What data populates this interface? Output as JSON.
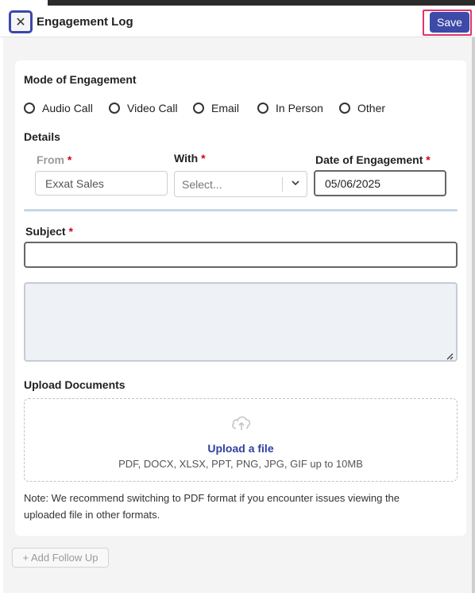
{
  "header": {
    "title": "Engagement Log",
    "close_label": "✕",
    "save_label": "Save"
  },
  "mode": {
    "label": "Mode of Engagement",
    "options": [
      "Audio Call",
      "Video Call",
      "Email",
      "In Person",
      "Other"
    ]
  },
  "details": {
    "label": "Details",
    "from_label": "From",
    "from_value": "Exxat Sales",
    "with_label": "With",
    "with_placeholder": "Select...",
    "date_label": "Date of Engagement",
    "date_value": "05/06/2025",
    "required_mark": "*"
  },
  "subject": {
    "label": "Subject",
    "value": ""
  },
  "upload": {
    "label": "Upload Documents",
    "title": "Upload a file",
    "subtitle": "PDF, DOCX, XLSX, PPT, PNG, JPG, GIF up to 10MB",
    "note": "Note: We recommend switching to PDF format if you encounter issues viewing the uploaded file in other formats."
  },
  "footer": {
    "follow_up_label": "+ Add Follow Up"
  },
  "colors": {
    "accent": "#3d4aa8",
    "required": "#d0021b",
    "focus_outline": "#e0336b"
  }
}
